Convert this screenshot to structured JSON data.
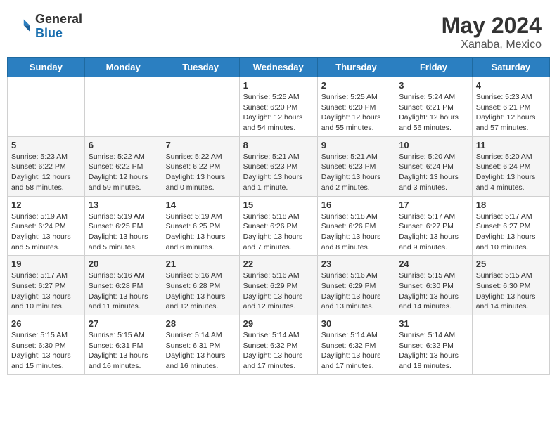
{
  "header": {
    "logo_general": "General",
    "logo_blue": "Blue",
    "title": "May 2024",
    "location": "Xanaba, Mexico"
  },
  "days_of_week": [
    "Sunday",
    "Monday",
    "Tuesday",
    "Wednesday",
    "Thursday",
    "Friday",
    "Saturday"
  ],
  "weeks": [
    [
      {
        "day": "",
        "sunrise": "",
        "sunset": "",
        "daylight": ""
      },
      {
        "day": "",
        "sunrise": "",
        "sunset": "",
        "daylight": ""
      },
      {
        "day": "",
        "sunrise": "",
        "sunset": "",
        "daylight": ""
      },
      {
        "day": "1",
        "sunrise": "Sunrise: 5:25 AM",
        "sunset": "Sunset: 6:20 PM",
        "daylight": "Daylight: 12 hours and 54 minutes."
      },
      {
        "day": "2",
        "sunrise": "Sunrise: 5:25 AM",
        "sunset": "Sunset: 6:20 PM",
        "daylight": "Daylight: 12 hours and 55 minutes."
      },
      {
        "day": "3",
        "sunrise": "Sunrise: 5:24 AM",
        "sunset": "Sunset: 6:21 PM",
        "daylight": "Daylight: 12 hours and 56 minutes."
      },
      {
        "day": "4",
        "sunrise": "Sunrise: 5:23 AM",
        "sunset": "Sunset: 6:21 PM",
        "daylight": "Daylight: 12 hours and 57 minutes."
      }
    ],
    [
      {
        "day": "5",
        "sunrise": "Sunrise: 5:23 AM",
        "sunset": "Sunset: 6:22 PM",
        "daylight": "Daylight: 12 hours and 58 minutes."
      },
      {
        "day": "6",
        "sunrise": "Sunrise: 5:22 AM",
        "sunset": "Sunset: 6:22 PM",
        "daylight": "Daylight: 12 hours and 59 minutes."
      },
      {
        "day": "7",
        "sunrise": "Sunrise: 5:22 AM",
        "sunset": "Sunset: 6:22 PM",
        "daylight": "Daylight: 13 hours and 0 minutes."
      },
      {
        "day": "8",
        "sunrise": "Sunrise: 5:21 AM",
        "sunset": "Sunset: 6:23 PM",
        "daylight": "Daylight: 13 hours and 1 minute."
      },
      {
        "day": "9",
        "sunrise": "Sunrise: 5:21 AM",
        "sunset": "Sunset: 6:23 PM",
        "daylight": "Daylight: 13 hours and 2 minutes."
      },
      {
        "day": "10",
        "sunrise": "Sunrise: 5:20 AM",
        "sunset": "Sunset: 6:24 PM",
        "daylight": "Daylight: 13 hours and 3 minutes."
      },
      {
        "day": "11",
        "sunrise": "Sunrise: 5:20 AM",
        "sunset": "Sunset: 6:24 PM",
        "daylight": "Daylight: 13 hours and 4 minutes."
      }
    ],
    [
      {
        "day": "12",
        "sunrise": "Sunrise: 5:19 AM",
        "sunset": "Sunset: 6:24 PM",
        "daylight": "Daylight: 13 hours and 5 minutes."
      },
      {
        "day": "13",
        "sunrise": "Sunrise: 5:19 AM",
        "sunset": "Sunset: 6:25 PM",
        "daylight": "Daylight: 13 hours and 5 minutes."
      },
      {
        "day": "14",
        "sunrise": "Sunrise: 5:19 AM",
        "sunset": "Sunset: 6:25 PM",
        "daylight": "Daylight: 13 hours and 6 minutes."
      },
      {
        "day": "15",
        "sunrise": "Sunrise: 5:18 AM",
        "sunset": "Sunset: 6:26 PM",
        "daylight": "Daylight: 13 hours and 7 minutes."
      },
      {
        "day": "16",
        "sunrise": "Sunrise: 5:18 AM",
        "sunset": "Sunset: 6:26 PM",
        "daylight": "Daylight: 13 hours and 8 minutes."
      },
      {
        "day": "17",
        "sunrise": "Sunrise: 5:17 AM",
        "sunset": "Sunset: 6:27 PM",
        "daylight": "Daylight: 13 hours and 9 minutes."
      },
      {
        "day": "18",
        "sunrise": "Sunrise: 5:17 AM",
        "sunset": "Sunset: 6:27 PM",
        "daylight": "Daylight: 13 hours and 10 minutes."
      }
    ],
    [
      {
        "day": "19",
        "sunrise": "Sunrise: 5:17 AM",
        "sunset": "Sunset: 6:27 PM",
        "daylight": "Daylight: 13 hours and 10 minutes."
      },
      {
        "day": "20",
        "sunrise": "Sunrise: 5:16 AM",
        "sunset": "Sunset: 6:28 PM",
        "daylight": "Daylight: 13 hours and 11 minutes."
      },
      {
        "day": "21",
        "sunrise": "Sunrise: 5:16 AM",
        "sunset": "Sunset: 6:28 PM",
        "daylight": "Daylight: 13 hours and 12 minutes."
      },
      {
        "day": "22",
        "sunrise": "Sunrise: 5:16 AM",
        "sunset": "Sunset: 6:29 PM",
        "daylight": "Daylight: 13 hours and 12 minutes."
      },
      {
        "day": "23",
        "sunrise": "Sunrise: 5:16 AM",
        "sunset": "Sunset: 6:29 PM",
        "daylight": "Daylight: 13 hours and 13 minutes."
      },
      {
        "day": "24",
        "sunrise": "Sunrise: 5:15 AM",
        "sunset": "Sunset: 6:30 PM",
        "daylight": "Daylight: 13 hours and 14 minutes."
      },
      {
        "day": "25",
        "sunrise": "Sunrise: 5:15 AM",
        "sunset": "Sunset: 6:30 PM",
        "daylight": "Daylight: 13 hours and 14 minutes."
      }
    ],
    [
      {
        "day": "26",
        "sunrise": "Sunrise: 5:15 AM",
        "sunset": "Sunset: 6:30 PM",
        "daylight": "Daylight: 13 hours and 15 minutes."
      },
      {
        "day": "27",
        "sunrise": "Sunrise: 5:15 AM",
        "sunset": "Sunset: 6:31 PM",
        "daylight": "Daylight: 13 hours and 16 minutes."
      },
      {
        "day": "28",
        "sunrise": "Sunrise: 5:14 AM",
        "sunset": "Sunset: 6:31 PM",
        "daylight": "Daylight: 13 hours and 16 minutes."
      },
      {
        "day": "29",
        "sunrise": "Sunrise: 5:14 AM",
        "sunset": "Sunset: 6:32 PM",
        "daylight": "Daylight: 13 hours and 17 minutes."
      },
      {
        "day": "30",
        "sunrise": "Sunrise: 5:14 AM",
        "sunset": "Sunset: 6:32 PM",
        "daylight": "Daylight: 13 hours and 17 minutes."
      },
      {
        "day": "31",
        "sunrise": "Sunrise: 5:14 AM",
        "sunset": "Sunset: 6:32 PM",
        "daylight": "Daylight: 13 hours and 18 minutes."
      },
      {
        "day": "",
        "sunrise": "",
        "sunset": "",
        "daylight": ""
      }
    ]
  ]
}
